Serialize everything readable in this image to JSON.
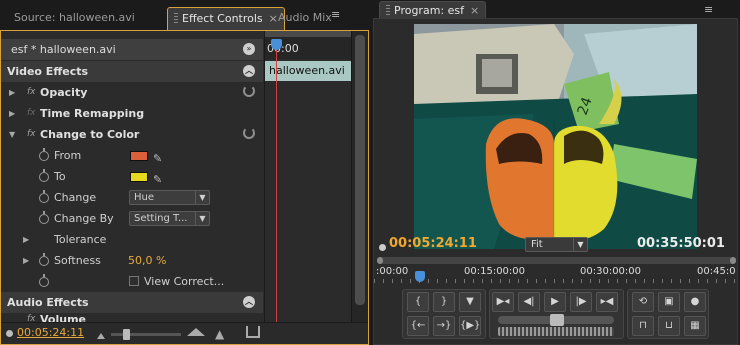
{
  "left_panel": {
    "tabs": [
      {
        "label": "Source: halloween.avi"
      },
      {
        "label": "Effect Controls",
        "active": true
      },
      {
        "label": "Audio Mix"
      }
    ],
    "sequence_clip": "esf * halloween.avi",
    "timecode_ruler": "00:00",
    "timeline_clip": "halloween.avi",
    "sections": {
      "video_effects": "Video Effects",
      "audio_effects": "Audio Effects"
    },
    "effects": {
      "opacity": "Opacity",
      "time_remapping": "Time Remapping",
      "change_to_color": "Change to Color",
      "volume": "Volume"
    },
    "fx_badge": "fx",
    "params": {
      "from": {
        "label": "From",
        "color": "#d9603a"
      },
      "to": {
        "label": "To",
        "color": "#e6d81e"
      },
      "change": {
        "label": "Change",
        "value": "Hue"
      },
      "change_by": {
        "label": "Change By",
        "value": "Setting T..."
      },
      "tolerance": {
        "label": "Tolerance"
      },
      "softness": {
        "label": "Softness",
        "value": "50,0 %"
      },
      "view_correction": {
        "label": "View Correct...",
        "checked": false
      }
    },
    "footer_timecode": "00:05:24:11"
  },
  "program_monitor": {
    "tab_label": "Program: esf",
    "current_timecode": "00:05:24:11",
    "zoom": "Fit",
    "duration": "00:35:50:01",
    "ruler_ticks": [
      ":00:00",
      "00:15:00:00",
      "00:30:00:00",
      "00:45:0"
    ],
    "tag_text": "24",
    "accent": "#f0a830"
  }
}
